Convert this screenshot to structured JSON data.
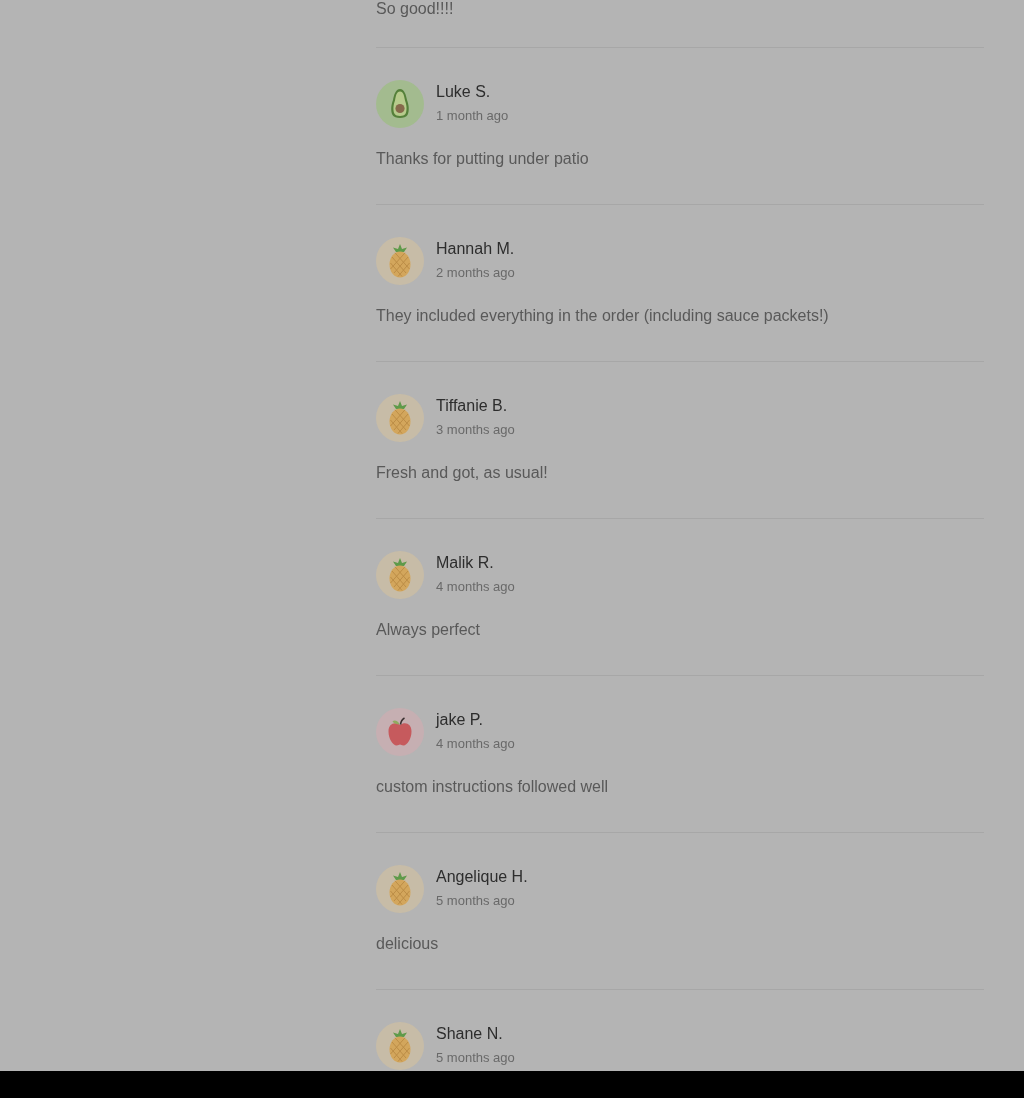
{
  "partial_review": {
    "comment": "So good!!!!"
  },
  "reviews": [
    {
      "kind": "avocado",
      "name": "Luke S.",
      "time": "1 month ago",
      "comment": "Thanks for putting under patio"
    },
    {
      "kind": "pineapple",
      "name": "Hannah M.",
      "time": "2 months ago",
      "comment": "They included everything in the order (including sauce packets!)"
    },
    {
      "kind": "pineapple",
      "name": "Tiffanie B.",
      "time": "3 months ago",
      "comment": "Fresh and got, as usual!"
    },
    {
      "kind": "pineapple",
      "name": "Malik R.",
      "time": "4 months ago",
      "comment": "Always perfect"
    },
    {
      "kind": "apple",
      "name": "jake P.",
      "time": "4 months ago",
      "comment": "custom instructions followed well"
    },
    {
      "kind": "pineapple",
      "name": "Angelique H.",
      "time": "5 months ago",
      "comment": "delicious"
    },
    {
      "kind": "pineapple",
      "name": "Shane N.",
      "time": "5 months ago"
    }
  ]
}
